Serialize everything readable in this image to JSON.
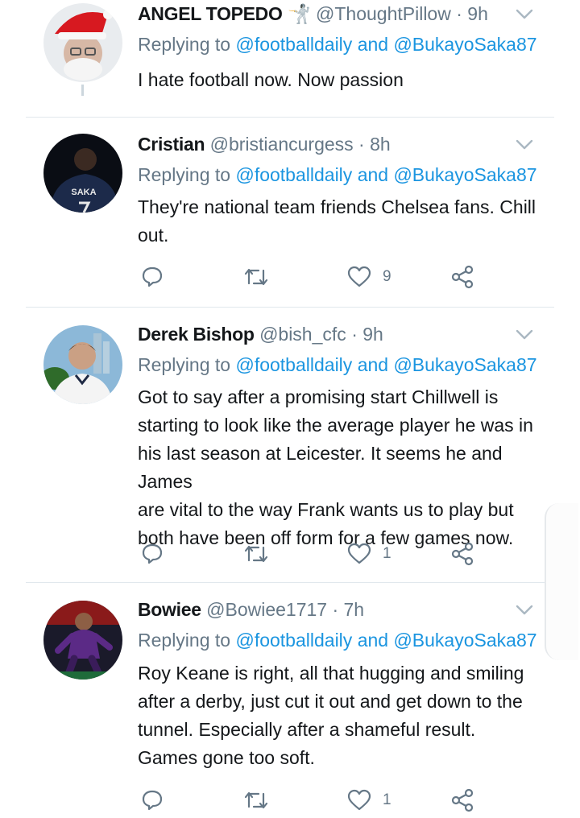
{
  "tweets": [
    {
      "name": "ANGEL TOPEDO",
      "emoji": "🤺",
      "handle": "@ThoughtPillow",
      "time": "· 9h",
      "reply_prefix": "Replying to",
      "mention1": "@footballdaily",
      "and": "and",
      "mention2": "@BukayoSaka87",
      "text": "I hate football now. Now passion",
      "likes": ""
    },
    {
      "name": "Cristian",
      "handle": "@bristiancurgess",
      "time": "· 8h",
      "reply_prefix": "Replying to",
      "mention1": "@footballdaily",
      "and": "and",
      "mention2": "@BukayoSaka87",
      "text_lines": [
        "They're national team friends Chelsea fans. Chill",
        "out."
      ],
      "avatar_jersey_text": "SAKA",
      "likes": "9"
    },
    {
      "name": "Derek Bishop",
      "handle": "@bish_cfc",
      "time": "· 9h",
      "reply_prefix": "Replying to",
      "mention1": "@footballdaily",
      "and": "and",
      "mention2": "@BukayoSaka87",
      "text_lines": [
        "Got to say after a promising start Chillwell is",
        "starting to look like the average player he was in",
        "his last season at Leicester. It seems he and James",
        "are vital to the way Frank wants us to play but",
        "both have been off form for a few games now."
      ],
      "likes": "1"
    },
    {
      "name": "Bowiee",
      "handle": "@Bowiee1717",
      "time": "· 7h",
      "reply_prefix": "Replying to",
      "mention1": "@footballdaily",
      "and": "and",
      "mention2": "@BukayoSaka87",
      "text_lines": [
        "Roy Keane is right, all that hugging and smiling",
        "after a derby, just cut it out and get down to the",
        "tunnel. Especially after a shameful result.",
        "Games gone too soft."
      ],
      "likes": "1"
    }
  ],
  "colors": {
    "link": "#1b95e0",
    "muted": "#657786",
    "divider": "#e1e8ed"
  },
  "icons": [
    "chevron-down-icon",
    "reply-icon",
    "retweet-icon",
    "like-icon",
    "share-icon"
  ]
}
